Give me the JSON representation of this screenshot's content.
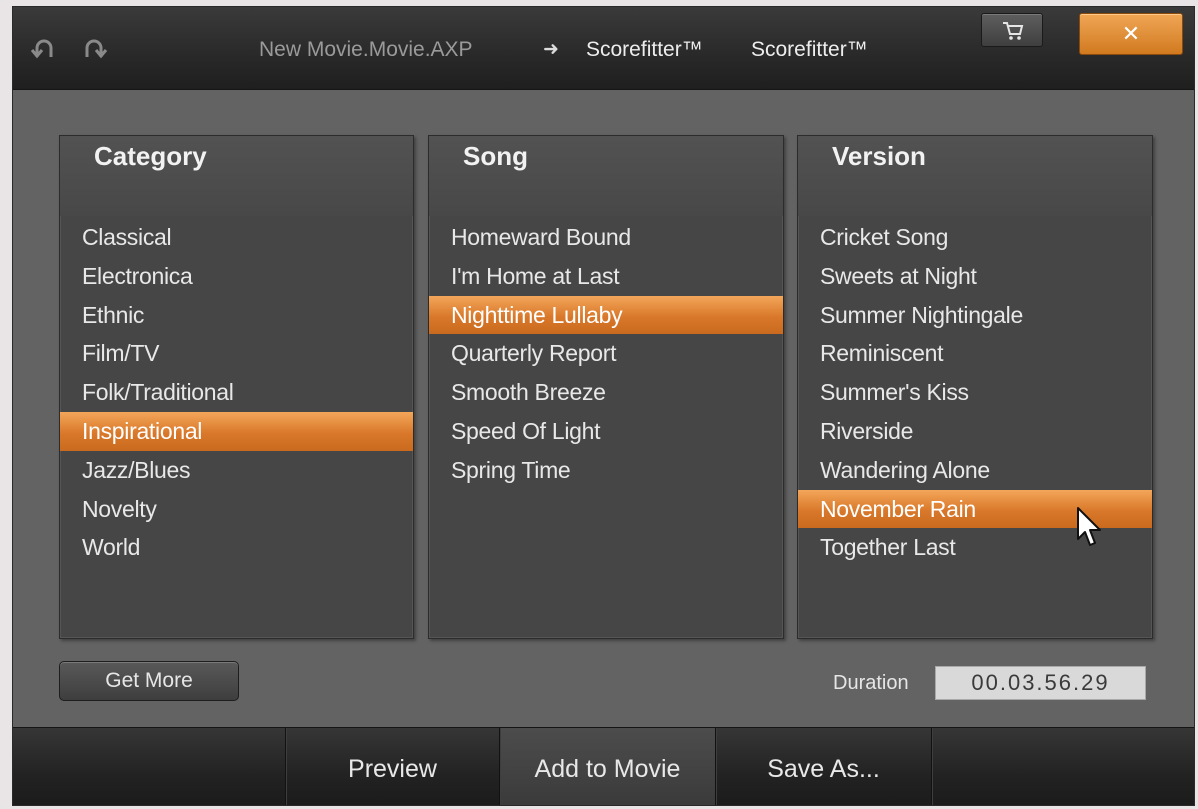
{
  "titlebar": {
    "project": "New Movie.Movie.AXP",
    "arrow": "➜",
    "tool": "Scorefitter™",
    "tool_repeat": "Scorefitter™",
    "close_label": "✕",
    "icons": [
      "undo-icon",
      "redo-icon",
      "cart-icon",
      "close-icon"
    ]
  },
  "category": {
    "header": "Category",
    "items": [
      "Classical",
      "Electronica",
      "Ethnic",
      "Film/TV",
      "Folk/Traditional",
      "Inspirational",
      "Jazz/Blues",
      "Novelty",
      "World"
    ],
    "selected": "Inspirational"
  },
  "song": {
    "header": "Song",
    "items": [
      "Homeward Bound",
      "I'm Home at Last",
      "Nighttime Lullaby",
      "Quarterly Report",
      "Smooth Breeze",
      "Speed Of Light",
      "Spring Time"
    ],
    "selected": "Nighttime Lullaby"
  },
  "version": {
    "header": "Version",
    "items": [
      "Cricket Song",
      "Sweets at Night",
      "Summer Nightingale",
      "Reminiscent",
      "Summer's Kiss",
      "Riverside",
      "Wandering Alone",
      "November Rain",
      "Together Last"
    ],
    "selected": "November Rain"
  },
  "controls": {
    "get_more": "Get More",
    "duration_label": "Duration",
    "duration_value": "00.03.56.29"
  },
  "actions": {
    "preview": "Preview",
    "add_to_movie": "Add to Movie",
    "save_as": "Save As..."
  },
  "colors": {
    "accent": "#e08a34",
    "background": "#636363",
    "panel": "#464646"
  }
}
